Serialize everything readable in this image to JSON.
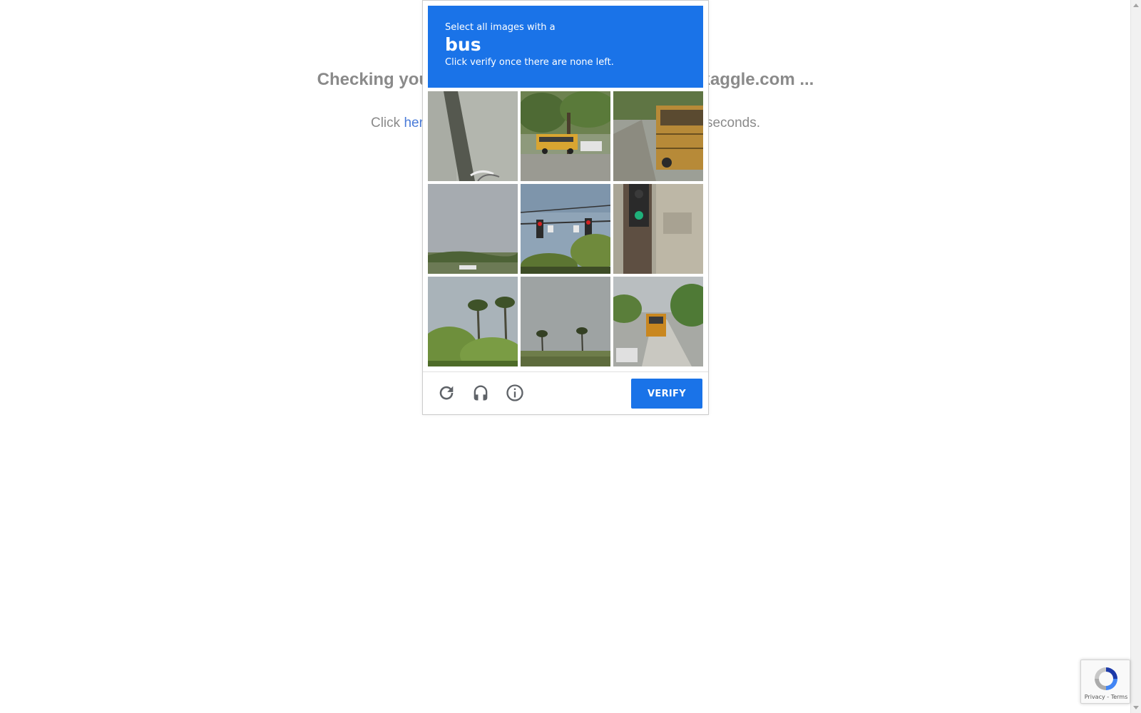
{
  "page": {
    "heading": "Checking your browser before accessing www.kaggle.com ...",
    "redirect_prefix": "Click ",
    "redirect_link": "here",
    "redirect_suffix": " if you are not automatically redirected after 5 seconds."
  },
  "captcha": {
    "intro": "Select all images with a",
    "target_word": "bus",
    "hint": "Click verify once there are none left.",
    "tiles": [
      {
        "label": "tile 1",
        "scene": "pavement-shadow"
      },
      {
        "label": "tile 2",
        "scene": "school-bus"
      },
      {
        "label": "tile 3",
        "scene": "bus-side"
      },
      {
        "label": "tile 4",
        "scene": "sky-horizon"
      },
      {
        "label": "tile 5",
        "scene": "traffic-lights"
      },
      {
        "label": "tile 6",
        "scene": "traffic-signal-wall"
      },
      {
        "label": "tile 7",
        "scene": "palm-trees"
      },
      {
        "label": "tile 8",
        "scene": "palm-trees-distant"
      },
      {
        "label": "tile 9",
        "scene": "school-bus-road"
      }
    ],
    "footer_icons": [
      "reload-icon",
      "headphones-icon",
      "info-icon"
    ],
    "verify_label": "VERIFY",
    "accent_color": "#1a73e8"
  },
  "badge": {
    "links": "Privacy - Terms"
  }
}
